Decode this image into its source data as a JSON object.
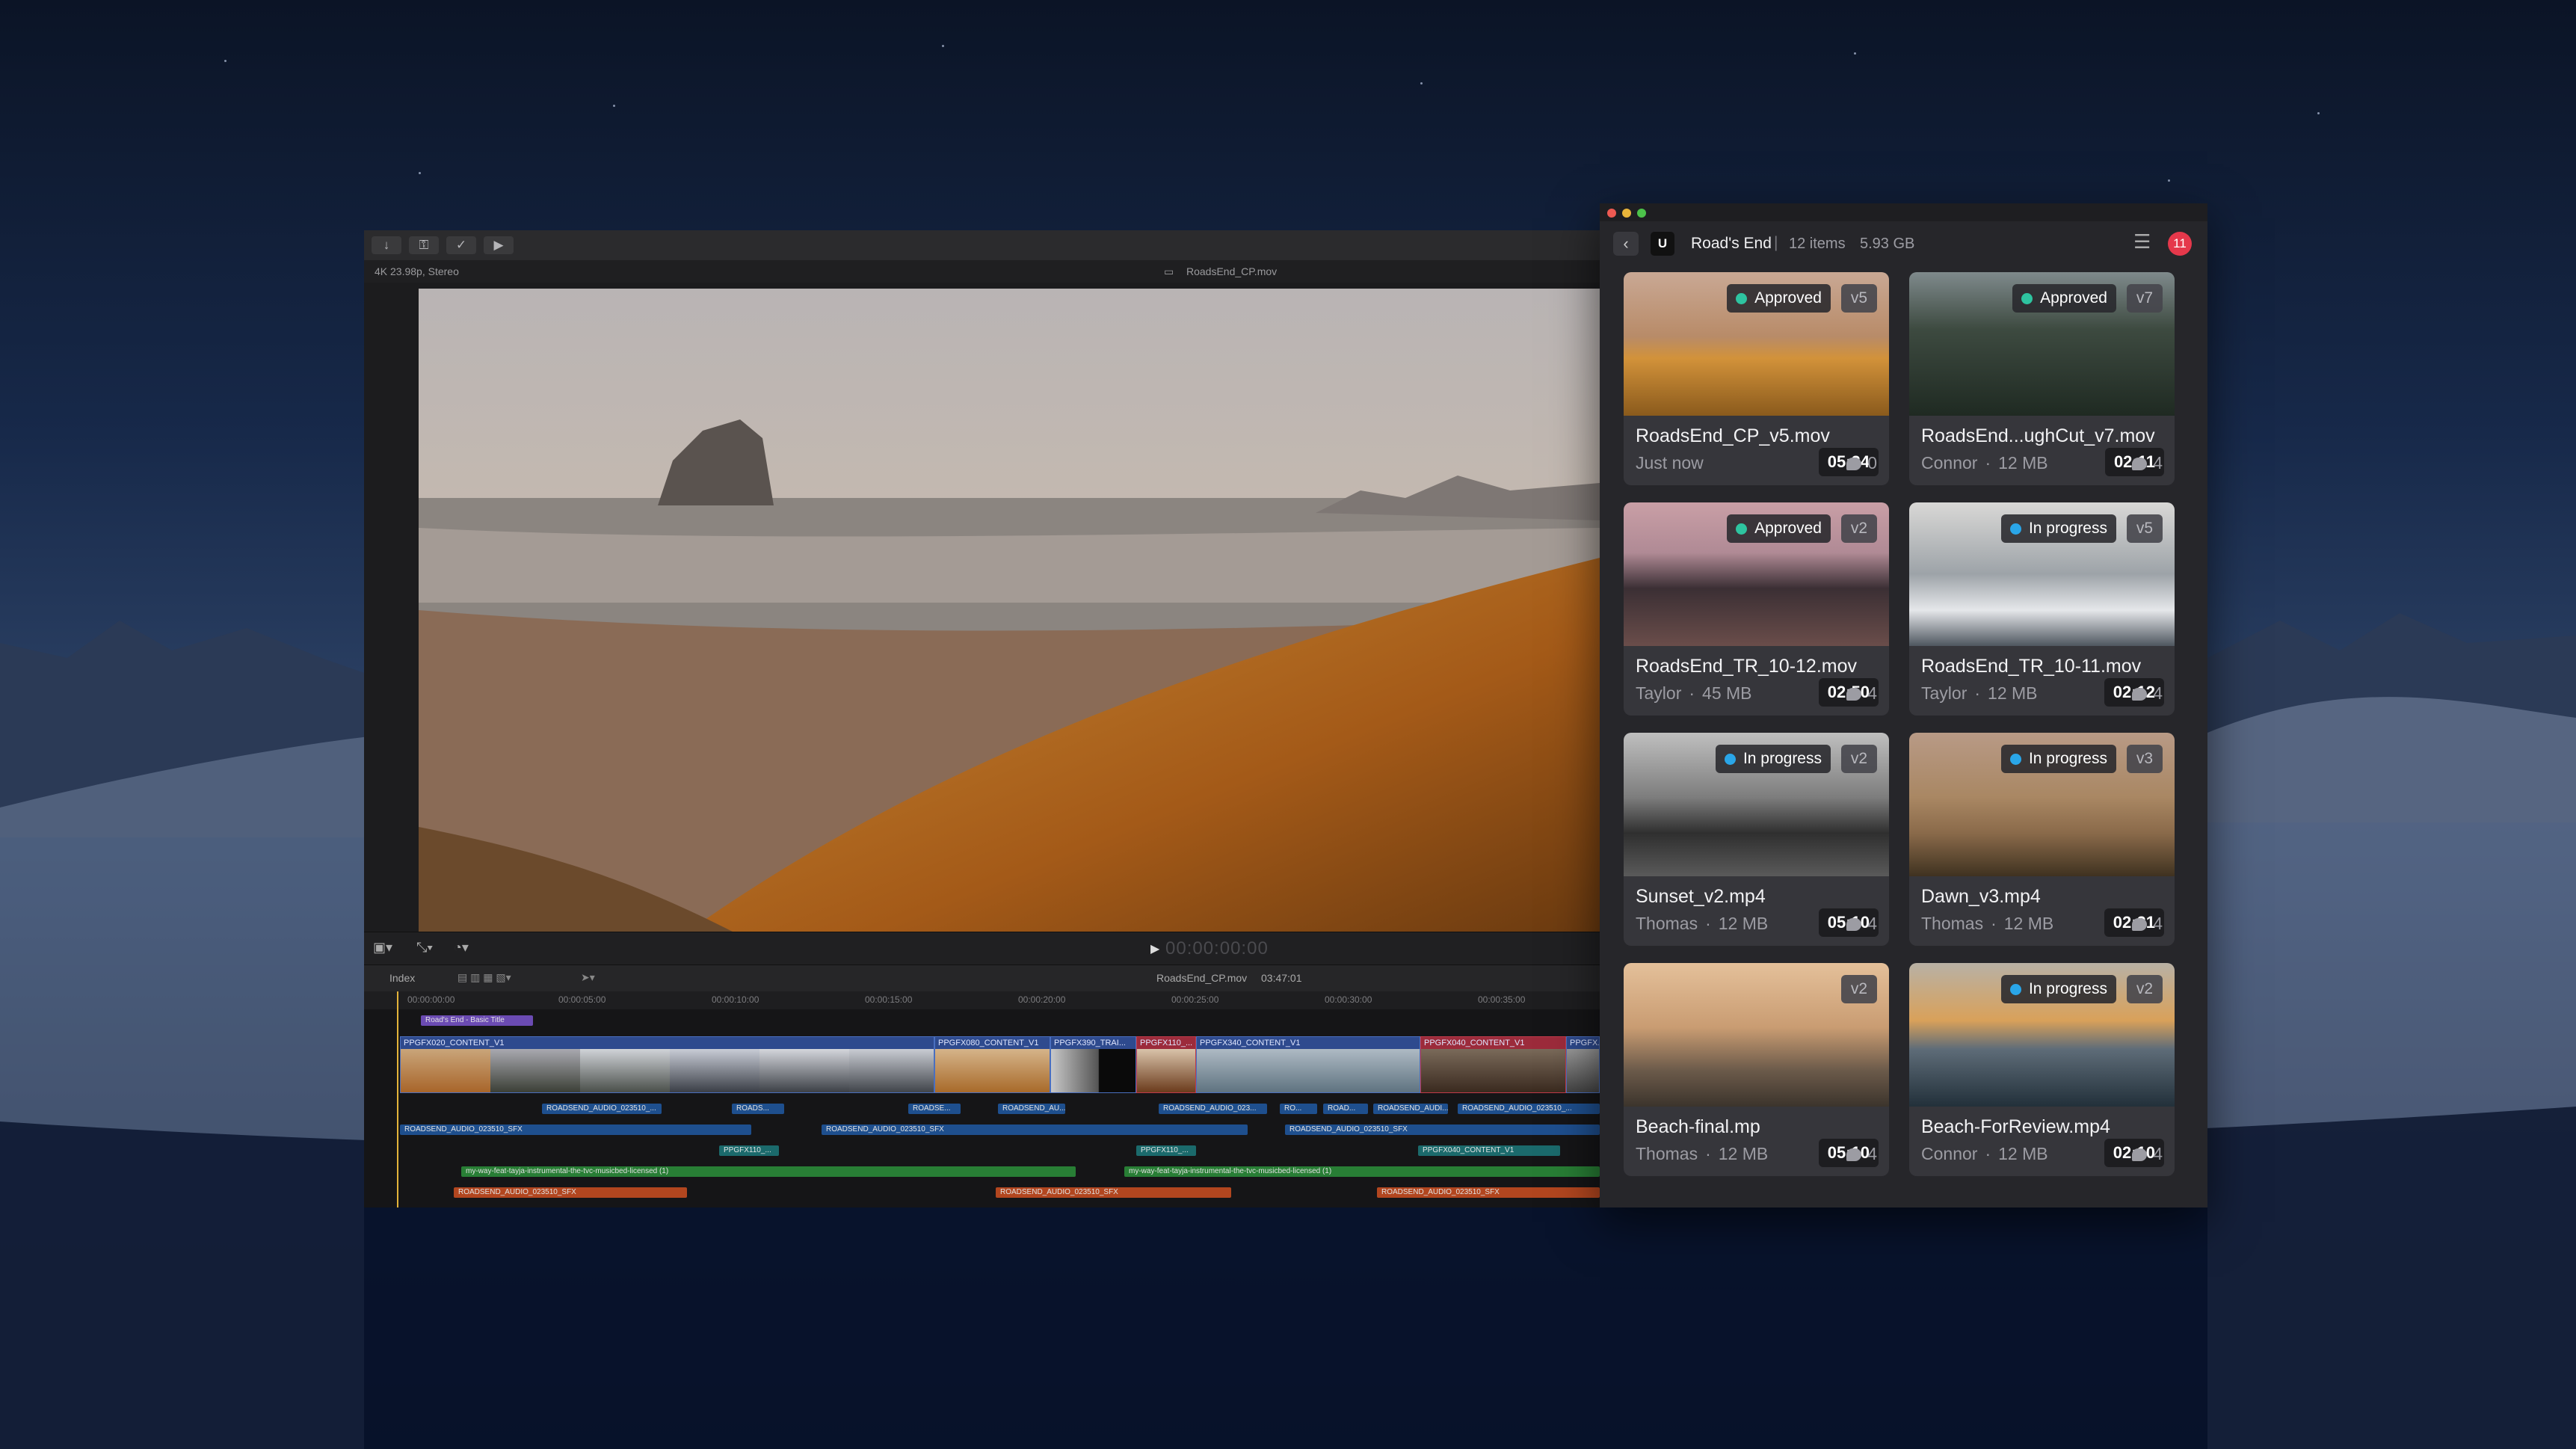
{
  "editor": {
    "toolbar_icons": [
      "import-icon",
      "keyword-icon",
      "check-icon",
      "share-icon"
    ],
    "format_info": "4K 23.98p, Stereo",
    "viewer_filename": "RoadsEnd_CP.mov",
    "playback_timecode": "00:00:00:00",
    "timeline": {
      "index_label": "Index",
      "project_name": "RoadsEnd_CP.mov",
      "project_duration": "03:47:01",
      "ruler": [
        "00:00:00:00",
        "00:00:05:00",
        "00:00:10:00",
        "00:00:15:00",
        "00:00:20:00",
        "00:00:25:00",
        "00:00:30:00",
        "00:00:35:00"
      ],
      "title_clip": "Road's End - Basic Title",
      "video_clips": [
        "PPGFX020_CONTENT_V1",
        "PPGFX080_CONTENT_V1",
        "PPGFX390_TRAI...",
        "PPGFX110_...",
        "PPGFX340_CONTENT_V1",
        "PPGFX040_CONTENT_V1",
        "PPGFX..."
      ],
      "audio_row1": [
        "ROADSEND_AUDIO_023510_...",
        "ROADS...",
        "ROADSE...",
        "ROADSEND_AU...",
        "ROADSEND_AUDIO_023...",
        "RO...",
        "ROAD...",
        "ROADSEND_AUDI...",
        "ROADSEND_AUDIO_023510_..."
      ],
      "audio_row2": [
        "ROADSEND_AUDIO_023510_SFX",
        "ROADSEND_AUDIO_023510_SFX",
        "ROADSEND_AUDIO_023510_SFX"
      ],
      "connected_row": [
        "PPGFX110_...",
        "PPGFX110_...",
        "PPGFX040_CONTENT_V1"
      ],
      "music_row": [
        "my-way-feat-tayja-instrumental-the-tvc-musicbed-licensed (1)",
        "my-way-feat-tayja-instrumental-the-tvc-musicbed-licensed (1)"
      ],
      "sfx_row": [
        "ROADSEND_AUDIO_023510_SFX",
        "ROADSEND_AUDIO_023510_SFX",
        "ROADSEND_AUDIO_023510_SFX"
      ]
    }
  },
  "panel": {
    "logo": "U",
    "project_name": "Road's End",
    "separator": "|",
    "item_count": "12 items",
    "total_size": "5.93 GB",
    "notification_count": "11",
    "colors": {
      "approved": "#2ec4a0",
      "in_progress": "#2aa6e8",
      "notification": "#e5384b"
    },
    "cards": [
      {
        "status": "Approved",
        "version": "v5",
        "duration": "05:24",
        "filename": "RoadsEnd_CP_v5.mov",
        "owner": "Just now",
        "size": "",
        "comments": "0"
      },
      {
        "status": "Approved",
        "version": "v7",
        "duration": "02:11",
        "filename": "RoadsEnd...ughCut_v7.mov",
        "owner": "Connor",
        "size": "12 MB",
        "comments": "4"
      },
      {
        "status": "Approved",
        "version": "v2",
        "duration": "02:50",
        "filename": "RoadsEnd_TR_10-12.mov",
        "owner": "Taylor",
        "size": "45 MB",
        "comments": "4"
      },
      {
        "status": "In progress",
        "version": "v5",
        "duration": "02:12",
        "filename": "RoadsEnd_TR_10-11.mov",
        "owner": "Taylor",
        "size": "12 MB",
        "comments": "4"
      },
      {
        "status": "In progress",
        "version": "v2",
        "duration": "05:10",
        "filename": "Sunset_v2.mp4",
        "owner": "Thomas",
        "size": "12 MB",
        "comments": "4"
      },
      {
        "status": "In progress",
        "version": "v3",
        "duration": "02:21",
        "filename": "Dawn_v3.mp4",
        "owner": "Thomas",
        "size": "12 MB",
        "comments": "4"
      },
      {
        "status": "",
        "version": "v2",
        "duration": "05:10",
        "filename": "Beach-final.mp",
        "owner": "Thomas",
        "size": "12 MB",
        "comments": "4"
      },
      {
        "status": "In progress",
        "version": "v2",
        "duration": "02:10",
        "filename": "Beach-ForReview.mp4",
        "owner": "Connor",
        "size": "12 MB",
        "comments": "4"
      }
    ]
  }
}
